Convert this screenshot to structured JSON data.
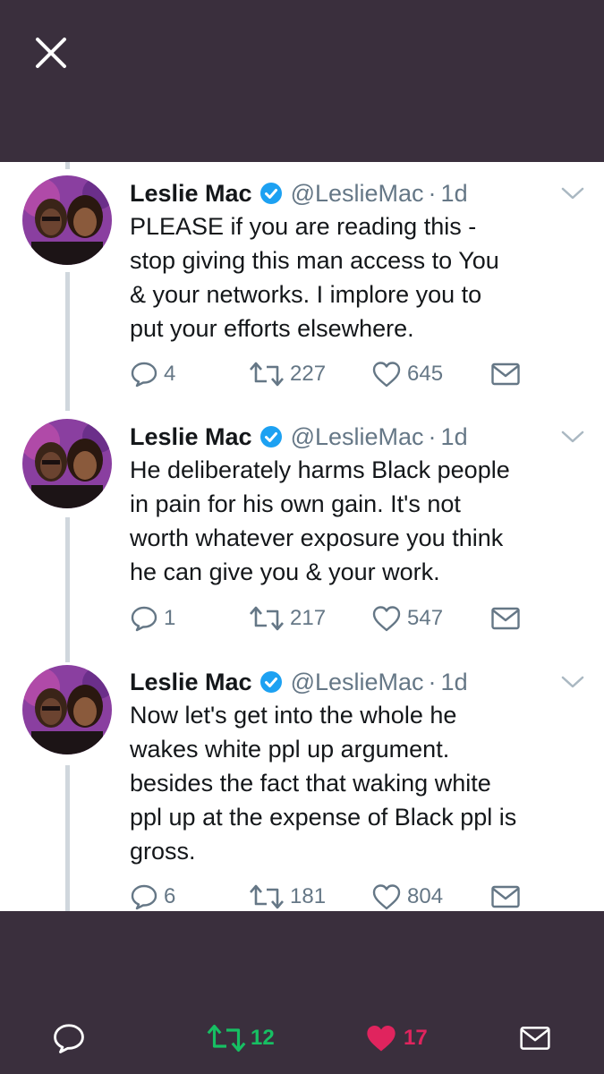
{
  "colors": {
    "background": "#3a2f3d",
    "retweet_active": "#17bf63",
    "like_active": "#e0245e",
    "verified": "#1da1f2",
    "secondary_text": "#657786"
  },
  "header": {
    "close_icon": "close-icon"
  },
  "tweets": [
    {
      "name": "Leslie Mac",
      "handle": "@LeslieMac",
      "separator": "·",
      "time": "1d",
      "text": "PLEASE if you are reading this -\nstop giving this man access to You\n& your networks. I implore you to\nput your efforts elsewhere.",
      "replies": "4",
      "retweets": "227",
      "likes": "645"
    },
    {
      "name": "Leslie Mac",
      "handle": "@LeslieMac",
      "separator": "·",
      "time": "1d",
      "text": "He deliberately harms Black people\nin pain for his own gain. It's not\nworth whatever exposure you think\nhe can give you & your work.",
      "replies": "1",
      "retweets": "217",
      "likes": "547"
    },
    {
      "name": "Leslie Mac",
      "handle": "@LeslieMac",
      "separator": "·",
      "time": "1d",
      "text": "Now let's get into the whole he\nwakes white ppl up argument.\nbesides the fact that waking white\nppl up at the expense of Black ppl is\ngross.",
      "replies": "6",
      "retweets": "181",
      "likes": "804"
    }
  ],
  "bottom_bar": {
    "retweets": "12",
    "likes": "17"
  }
}
